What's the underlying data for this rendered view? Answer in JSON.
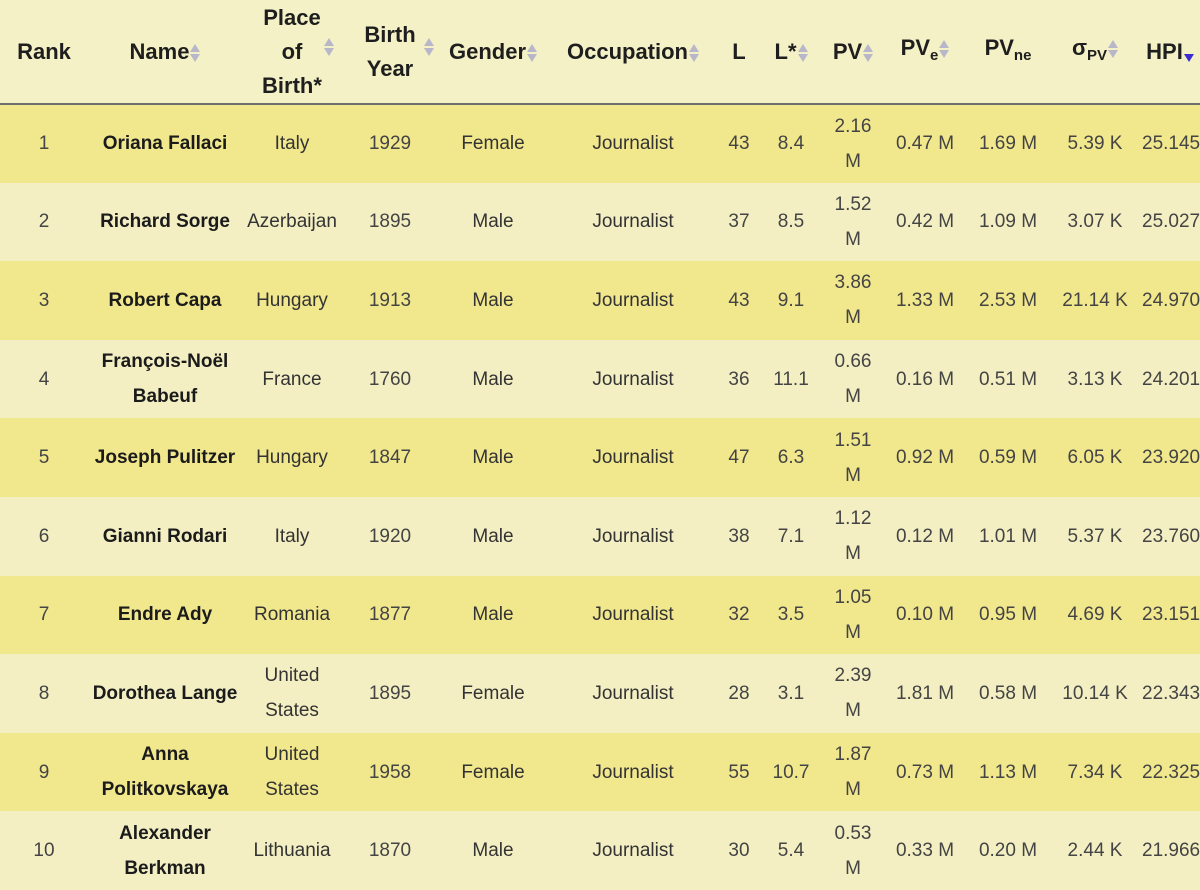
{
  "table": {
    "columns": [
      {
        "key": "rank",
        "label": "Rank",
        "sub": "",
        "sortable": false
      },
      {
        "key": "name",
        "label": "Name",
        "sub": "",
        "sortable": true
      },
      {
        "key": "place",
        "label": "Place of Birth*",
        "sub": "",
        "sortable": true
      },
      {
        "key": "birth_year",
        "label": "Birth Year",
        "sub": "",
        "sortable": true
      },
      {
        "key": "gender",
        "label": "Gender",
        "sub": "",
        "sortable": true
      },
      {
        "key": "occupation",
        "label": "Occupation",
        "sub": "",
        "sortable": true
      },
      {
        "key": "l",
        "label": "L",
        "sub": "",
        "sortable": true
      },
      {
        "key": "l_star",
        "label": "L*",
        "sub": "",
        "sortable": true
      },
      {
        "key": "pv",
        "label": "PV",
        "sub": "",
        "sortable": true
      },
      {
        "key": "pv_e",
        "label": "PV",
        "sub": "e",
        "sortable": true
      },
      {
        "key": "pv_ne",
        "label": "PV",
        "sub": "ne",
        "sortable": true
      },
      {
        "key": "sigma_pv",
        "label": "σ",
        "sub": "PV",
        "sortable": true
      },
      {
        "key": "hpi",
        "label": "HPI",
        "sub": "",
        "sortable": true,
        "sort_active": "desc"
      }
    ],
    "rows": [
      {
        "rank": "1",
        "name": "Oriana Fallaci",
        "place": "Italy",
        "birth_year": "1929",
        "gender": "Female",
        "occupation": "Journalist",
        "l": "43",
        "l_star": "8.4",
        "pv": "2.16 M",
        "pv_e": "0.47 M",
        "pv_ne": "1.69 M",
        "sigma_pv": "5.39 K",
        "hpi": "25.145"
      },
      {
        "rank": "2",
        "name": "Richard Sorge",
        "place": "Azerbaijan",
        "birth_year": "1895",
        "gender": "Male",
        "occupation": "Journalist",
        "l": "37",
        "l_star": "8.5",
        "pv": "1.52 M",
        "pv_e": "0.42 M",
        "pv_ne": "1.09 M",
        "sigma_pv": "3.07 K",
        "hpi": "25.027"
      },
      {
        "rank": "3",
        "name": "Robert Capa",
        "place": "Hungary",
        "birth_year": "1913",
        "gender": "Male",
        "occupation": "Journalist",
        "l": "43",
        "l_star": "9.1",
        "pv": "3.86 M",
        "pv_e": "1.33 M",
        "pv_ne": "2.53 M",
        "sigma_pv": "21.14 K",
        "hpi": "24.970"
      },
      {
        "rank": "4",
        "name": "François-Noël Babeuf",
        "place": "France",
        "birth_year": "1760",
        "gender": "Male",
        "occupation": "Journalist",
        "l": "36",
        "l_star": "11.1",
        "pv": "0.66 M",
        "pv_e": "0.16 M",
        "pv_ne": "0.51 M",
        "sigma_pv": "3.13 K",
        "hpi": "24.201"
      },
      {
        "rank": "5",
        "name": "Joseph Pulitzer",
        "place": "Hungary",
        "birth_year": "1847",
        "gender": "Male",
        "occupation": "Journalist",
        "l": "47",
        "l_star": "6.3",
        "pv": "1.51 M",
        "pv_e": "0.92 M",
        "pv_ne": "0.59 M",
        "sigma_pv": "6.05 K",
        "hpi": "23.920"
      },
      {
        "rank": "6",
        "name": "Gianni Rodari",
        "place": "Italy",
        "birth_year": "1920",
        "gender": "Male",
        "occupation": "Journalist",
        "l": "38",
        "l_star": "7.1",
        "pv": "1.12 M",
        "pv_e": "0.12 M",
        "pv_ne": "1.01 M",
        "sigma_pv": "5.37 K",
        "hpi": "23.760"
      },
      {
        "rank": "7",
        "name": "Endre Ady",
        "place": "Romania",
        "birth_year": "1877",
        "gender": "Male",
        "occupation": "Journalist",
        "l": "32",
        "l_star": "3.5",
        "pv": "1.05 M",
        "pv_e": "0.10 M",
        "pv_ne": "0.95 M",
        "sigma_pv": "4.69 K",
        "hpi": "23.151"
      },
      {
        "rank": "8",
        "name": "Dorothea Lange",
        "place": "United States",
        "birth_year": "1895",
        "gender": "Female",
        "occupation": "Journalist",
        "l": "28",
        "l_star": "3.1",
        "pv": "2.39 M",
        "pv_e": "1.81 M",
        "pv_ne": "0.58 M",
        "sigma_pv": "10.14 K",
        "hpi": "22.343"
      },
      {
        "rank": "9",
        "name": "Anna Politkovskaya",
        "place": "United States",
        "birth_year": "1958",
        "gender": "Female",
        "occupation": "Journalist",
        "l": "55",
        "l_star": "10.7",
        "pv": "1.87 M",
        "pv_e": "0.73 M",
        "pv_ne": "1.13 M",
        "sigma_pv": "7.34 K",
        "hpi": "22.325"
      },
      {
        "rank": "10",
        "name": "Alexander Berkman",
        "place": "Lithuania",
        "birth_year": "1870",
        "gender": "Male",
        "occupation": "Journalist",
        "l": "30",
        "l_star": "5.4",
        "pv": "0.53 M",
        "pv_e": "0.33 M",
        "pv_ne": "0.20 M",
        "sigma_pv": "2.44 K",
        "hpi": "21.966"
      }
    ],
    "icons": {
      "sort": "sort-arrows-icon",
      "sort_desc": "sort-descending-icon"
    },
    "colors": {
      "row_odd": "#f1e78d",
      "row_even": "#f3efc3",
      "sort_active": "#3b2bd1",
      "sort_idle": "#b7b7c9"
    }
  }
}
